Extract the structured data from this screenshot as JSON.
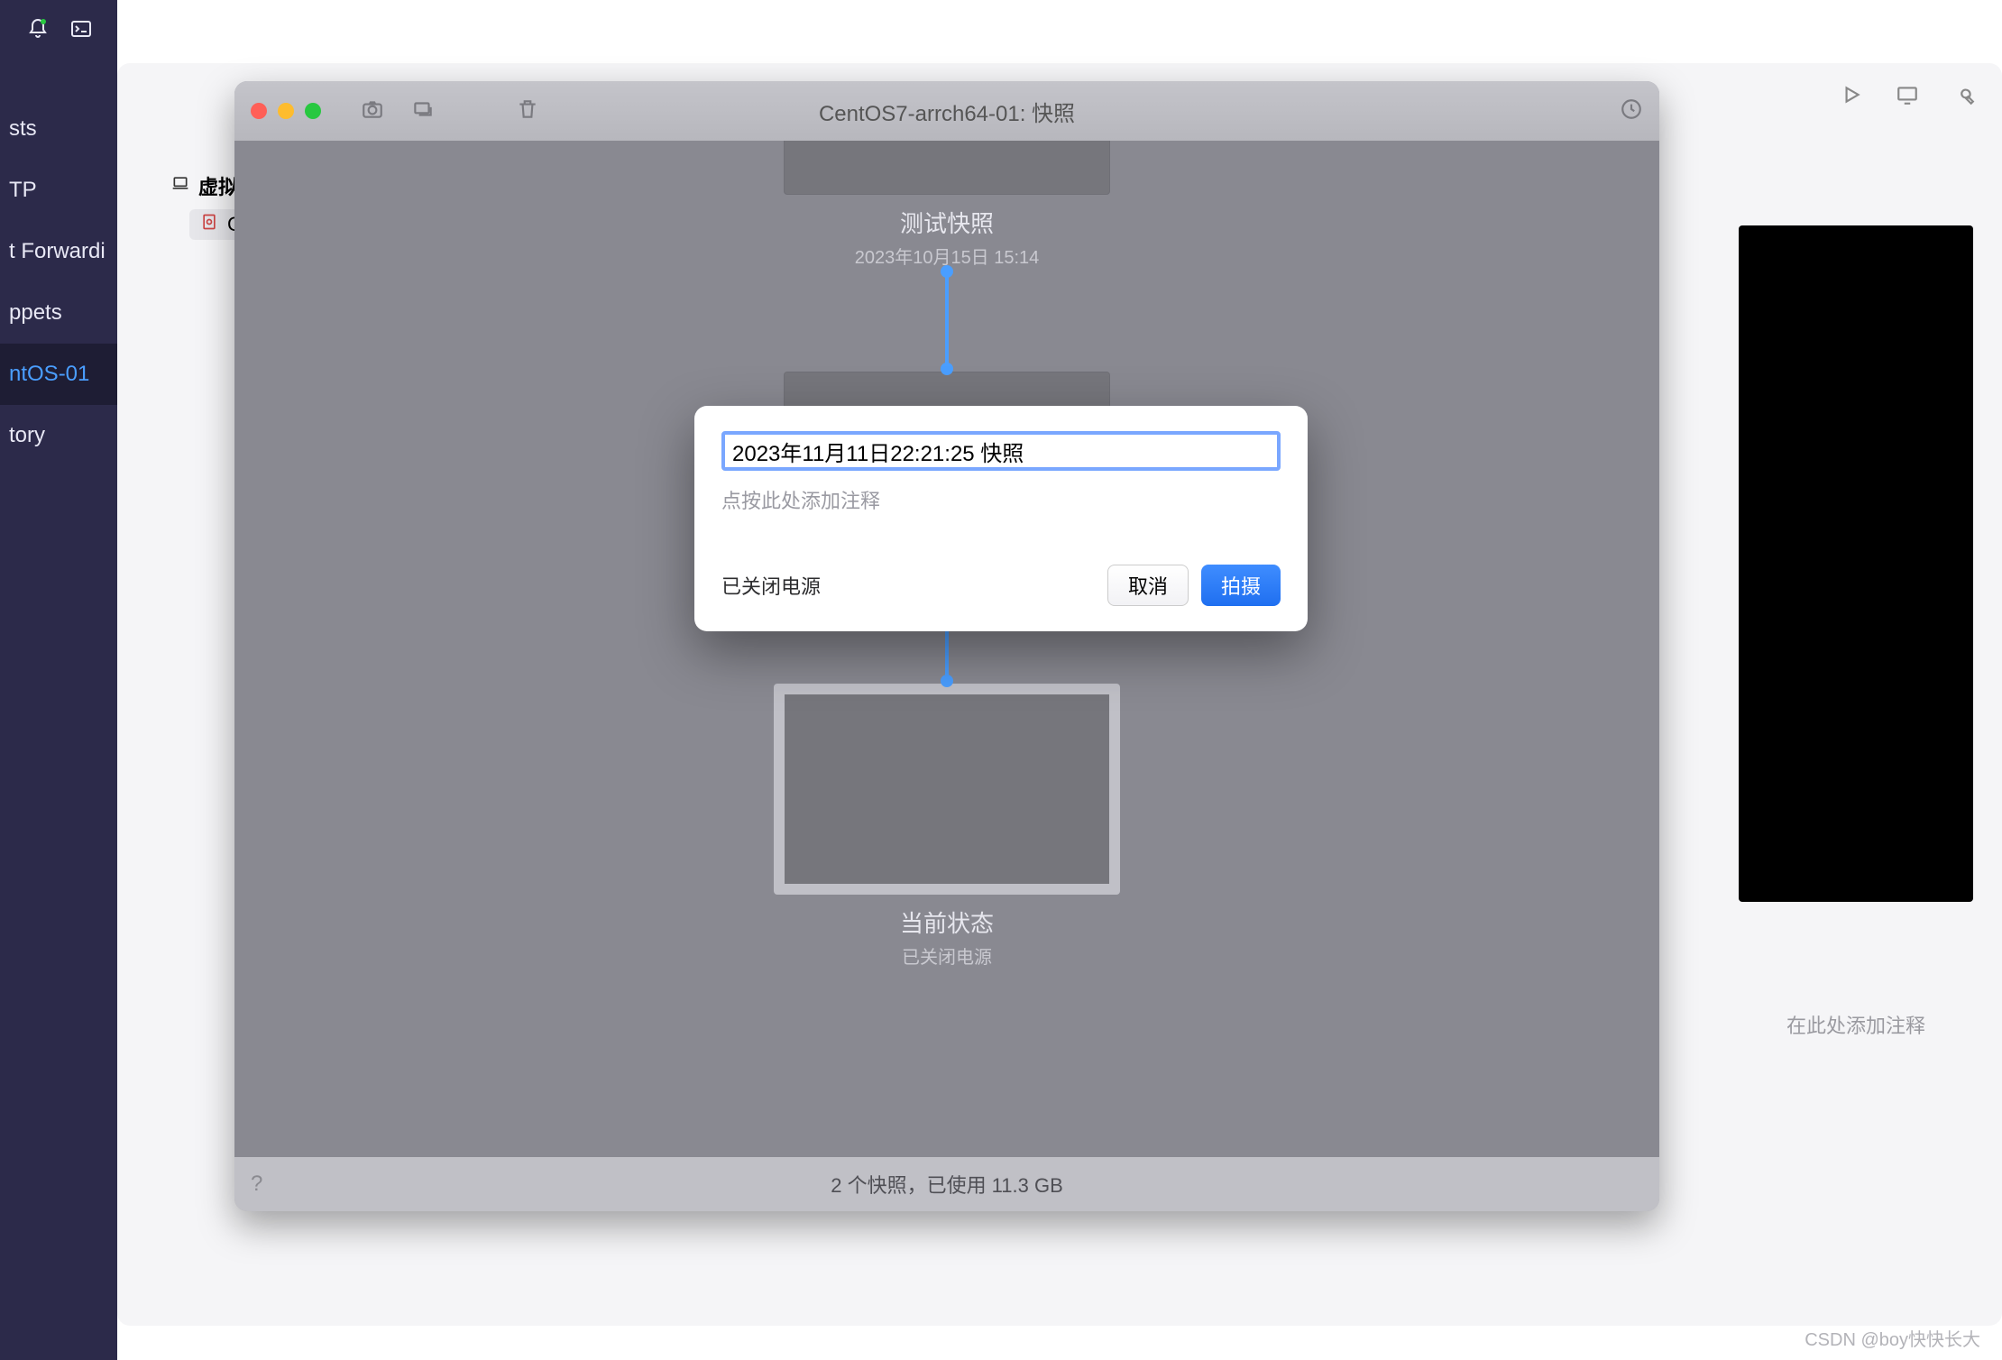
{
  "host_sidebar": {
    "items": [
      "sts",
      "TP",
      "t Forwardi",
      "ppets",
      "ntOS-01",
      "tory"
    ],
    "selected_index": 4
  },
  "vm_list": {
    "folder_label": "虚拟",
    "file_label": "C"
  },
  "right_pane": {
    "add_comment": "在此处添加注释"
  },
  "snapshot_window": {
    "title": "CentOS7-arrch64-01: 快照",
    "snap1": {
      "name": "测试快照",
      "timestamp": "2023年10月15日 15:14"
    },
    "current": {
      "name": "当前状态",
      "sub": "已关闭电源"
    },
    "footer": "2 个快照，已使用 11.3 GB"
  },
  "popover": {
    "name_value": "2023年11月11日22:21:25 快照",
    "notes_placeholder": "点按此处添加注释",
    "power_state": "已关闭电源",
    "cancel": "取消",
    "confirm": "拍摄"
  },
  "watermark": "CSDN @boy快快长大"
}
